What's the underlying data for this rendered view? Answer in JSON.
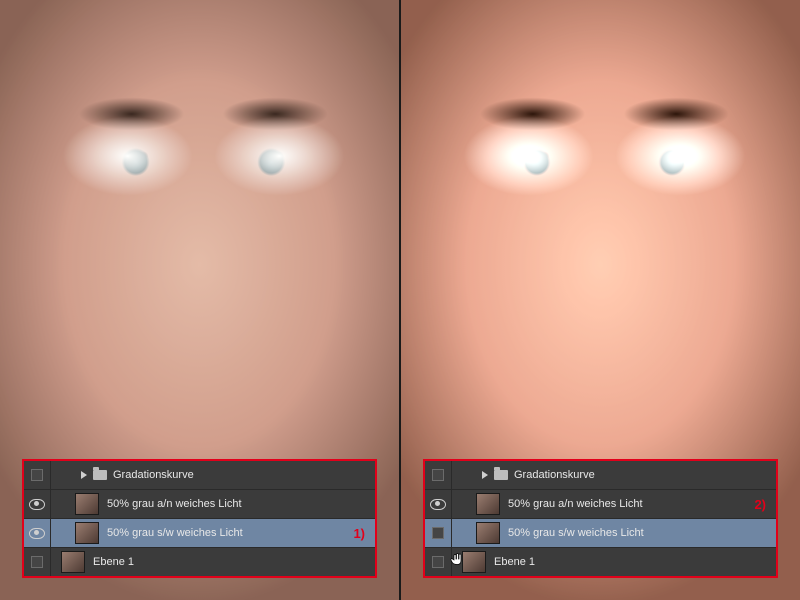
{
  "accent_color": "#e2001a",
  "selected_bg": "#6f86a3",
  "panels": {
    "left": {
      "callout": "1)",
      "callout_row_index": 2,
      "selected_index": 2,
      "rows": [
        {
          "kind": "group",
          "visible": false,
          "label": "Gradationskurve"
        },
        {
          "kind": "layer",
          "visible": true,
          "label": "50% grau a/n weiches Licht"
        },
        {
          "kind": "layer",
          "visible": true,
          "label": "50% grau s/w weiches Licht"
        },
        {
          "kind": "layer",
          "visible": false,
          "label": "Ebene 1"
        }
      ]
    },
    "right": {
      "callout": "2)",
      "callout_row_index": 1,
      "selected_index": 2,
      "rows": [
        {
          "kind": "group",
          "visible": false,
          "label": "Gradationskurve"
        },
        {
          "kind": "layer",
          "visible": true,
          "label": "50% grau a/n weiches Licht"
        },
        {
          "kind": "layer",
          "visible": false,
          "label": "50% grau s/w weiches Licht"
        },
        {
          "kind": "layer",
          "visible": false,
          "label": "Ebene 1"
        }
      ]
    }
  }
}
